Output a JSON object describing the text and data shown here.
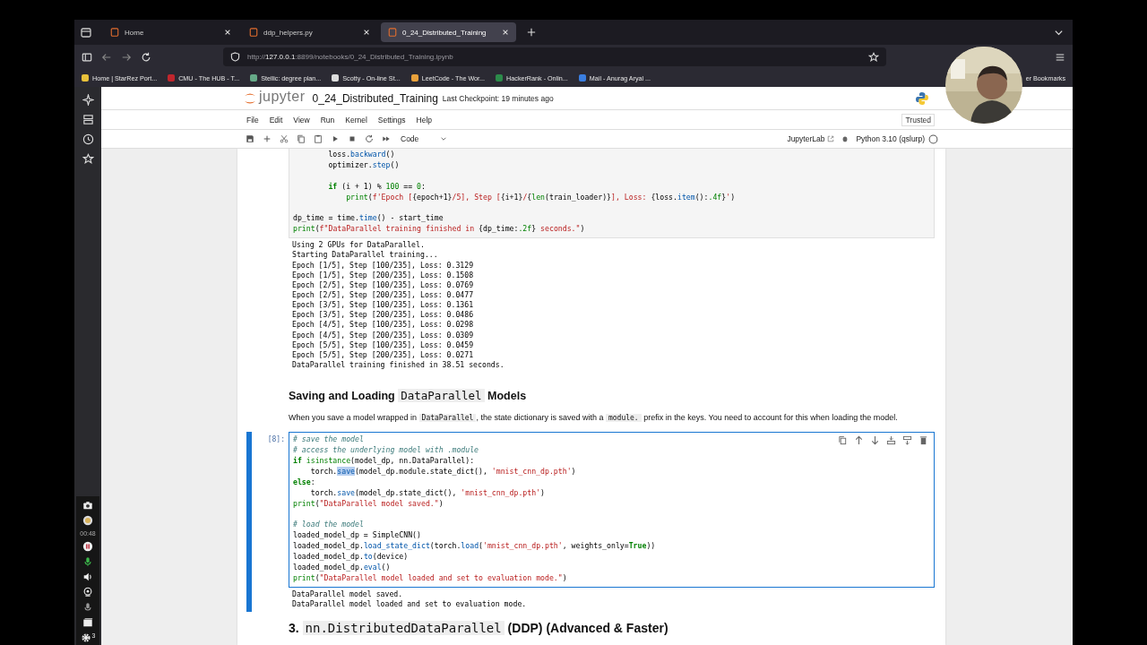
{
  "browser": {
    "tabs": [
      {
        "label": "Home",
        "selected": false
      },
      {
        "label": "ddp_helpers.py",
        "selected": false
      },
      {
        "label": "0_24_Distributed_Training",
        "selected": true
      }
    ],
    "url": {
      "host": "127.0.0.1",
      "prefix": "http://",
      "rest": ":8899/notebooks/0_24_Distributed_Training.ipynb"
    },
    "bookmarks": [
      "Home | StarRez Port...",
      "CMU - The HUB - T...",
      "Stellic: degree plan...",
      "Scotty - On-line St...",
      "LeetCode - The Wor...",
      "HackerRank - Onlin...",
      "Mail - Anurag Aryal ..."
    ],
    "bookmarks_end": "er Bookmarks"
  },
  "jupyter": {
    "logo": "jupyter",
    "title": "0_24_Distributed_Training",
    "checkpoint": "Last Checkpoint: 19 minutes ago",
    "menu": [
      "File",
      "Edit",
      "View",
      "Run",
      "Kernel",
      "Settings",
      "Help"
    ],
    "trusted": "Trusted",
    "cell_type": "Code",
    "jupyterlab": "JupyterLab",
    "kernel": "Python 3.10 (qslurp)"
  },
  "cells": [
    {
      "kind": "code",
      "selected": false,
      "lines": [
        {
          "seg": [
            {
              "kind": "plain",
              "text": "        loss."
            },
            {
              "kind": "attr",
              "text": "backward"
            },
            {
              "kind": "plain",
              "text": "()"
            }
          ]
        },
        {
          "seg": [
            {
              "kind": "plain",
              "text": "        optimizer."
            },
            {
              "kind": "attr",
              "text": "step"
            },
            {
              "kind": "plain",
              "text": "()"
            }
          ]
        },
        {
          "gap": true,
          "seg": [
            {
              "kind": "keyword",
              "text": "        if"
            },
            {
              "kind": "plain",
              "text": " (i + 1) % "
            },
            {
              "kind": "number",
              "text": "100"
            },
            {
              "kind": "plain",
              "text": " == "
            },
            {
              "kind": "number",
              "text": "0"
            },
            {
              "kind": "plain",
              "text": ":"
            }
          ]
        },
        {
          "seg": [
            {
              "kind": "builtin",
              "text": "            print"
            },
            {
              "kind": "plain",
              "text": "("
            },
            {
              "kind": "string",
              "text": "f'Epoch ["
            },
            {
              "kind": "plain",
              "text": "{epoch+1}"
            },
            {
              "kind": "string",
              "text": "/5], Step ["
            },
            {
              "kind": "plain",
              "text": "{i+1}"
            },
            {
              "kind": "string",
              "text": "/"
            },
            {
              "kind": "plain",
              "text": "{"
            },
            {
              "kind": "builtin",
              "text": "len"
            },
            {
              "kind": "plain",
              "text": "(train_loader)}"
            },
            {
              "kind": "string",
              "text": "], Loss: "
            },
            {
              "kind": "plain",
              "text": "{loss."
            },
            {
              "kind": "attr",
              "text": "item"
            },
            {
              "kind": "plain",
              "text": "():"
            },
            {
              "kind": "number",
              "text": ".4f"
            },
            {
              "kind": "plain",
              "text": "}"
            },
            {
              "kind": "string",
              "text": "'"
            },
            {
              "kind": "plain",
              "text": ")"
            }
          ]
        },
        {
          "gap": true,
          "seg": [
            {
              "kind": "plain",
              "text": "dp_time = time."
            },
            {
              "kind": "attr",
              "text": "time"
            },
            {
              "kind": "plain",
              "text": "() - start_time"
            }
          ]
        },
        {
          "seg": [
            {
              "kind": "builtin",
              "text": "print"
            },
            {
              "kind": "plain",
              "text": "("
            },
            {
              "kind": "string",
              "text": "f\"DataParallel training finished in "
            },
            {
              "kind": "plain",
              "text": "{dp_time:"
            },
            {
              "kind": "number",
              "text": ".2f"
            },
            {
              "kind": "plain",
              "text": "}"
            },
            {
              "kind": "string",
              "text": " seconds.\""
            },
            {
              "kind": "plain",
              "text": ")"
            }
          ]
        }
      ],
      "output": [
        "Using 2 GPUs for DataParallel.",
        "Starting DataParallel training...",
        "Epoch [1/5], Step [100/235], Loss: 0.3129",
        "Epoch [1/5], Step [200/235], Loss: 0.1508",
        "Epoch [2/5], Step [100/235], Loss: 0.0769",
        "Epoch [2/5], Step [200/235], Loss: 0.0477",
        "Epoch [3/5], Step [100/235], Loss: 0.1361",
        "Epoch [3/5], Step [200/235], Loss: 0.0486",
        "Epoch [4/5], Step [100/235], Loss: 0.0298",
        "Epoch [4/5], Step [200/235], Loss: 0.0309",
        "Epoch [5/5], Step [100/235], Loss: 0.0459",
        "Epoch [5/5], Step [200/235], Loss: 0.0271",
        "DataParallel training finished in 38.51 seconds."
      ]
    },
    {
      "kind": "markdown",
      "selected": false,
      "heading": {
        "kind": "h2",
        "parts": [
          {
            "text": "Saving and Loading ",
            "code": false
          },
          {
            "text": "DataParallel",
            "code": true
          },
          {
            "text": " Models",
            "code": false
          }
        ]
      },
      "paragraph": [
        {
          "text": "When you save a model wrapped in ",
          "code": false
        },
        {
          "text": "DataParallel",
          "code": true
        },
        {
          "text": ", the state dictionary is saved with a ",
          "code": false
        },
        {
          "text": "module.",
          "code": true
        },
        {
          "text": " prefix in the keys. You need to account for this when loading the model.",
          "code": false
        }
      ]
    },
    {
      "kind": "code",
      "selected": true,
      "prompt": "[8]:",
      "lines": [
        {
          "seg": [
            {
              "kind": "comment",
              "text": "# save the model"
            }
          ]
        },
        {
          "seg": [
            {
              "kind": "comment",
              "text": "# access the underlying model with .module"
            }
          ]
        },
        {
          "seg": [
            {
              "kind": "keyword",
              "text": "if"
            },
            {
              "kind": "builtin",
              "text": " isinstance"
            },
            {
              "kind": "plain",
              "text": "(model_dp, nn.DataParallel):"
            }
          ]
        },
        {
          "seg": [
            {
              "kind": "plain",
              "text": "    torch."
            },
            {
              "kind": "selected",
              "text": "save"
            },
            {
              "kind": "plain",
              "text": "(model_dp.module.state_dict(), "
            },
            {
              "kind": "string",
              "text": "'mnist_cnn_dp.pth'"
            },
            {
              "kind": "plain",
              "text": ")"
            }
          ]
        },
        {
          "seg": [
            {
              "kind": "keyword",
              "text": "else"
            },
            {
              "kind": "plain",
              "text": ":"
            }
          ]
        },
        {
          "seg": [
            {
              "kind": "plain",
              "text": "    torch."
            },
            {
              "kind": "attr",
              "text": "save"
            },
            {
              "kind": "plain",
              "text": "(model_dp.state_dict(), "
            },
            {
              "kind": "string",
              "text": "'mnist_cnn_dp.pth'"
            },
            {
              "kind": "plain",
              "text": ")"
            }
          ]
        },
        {
          "seg": [
            {
              "kind": "builtin",
              "text": "print"
            },
            {
              "kind": "plain",
              "text": "("
            },
            {
              "kind": "string",
              "text": "\"DataParallel model saved.\""
            },
            {
              "kind": "plain",
              "text": ")"
            }
          ]
        },
        {
          "gap": true,
          "seg": [
            {
              "kind": "comment",
              "text": "# load the model"
            }
          ]
        },
        {
          "seg": [
            {
              "kind": "plain",
              "text": "loaded_model_dp = SimpleCNN()"
            }
          ]
        },
        {
          "seg": [
            {
              "kind": "plain",
              "text": "loaded_model_dp."
            },
            {
              "kind": "attr",
              "text": "load_state_dict"
            },
            {
              "kind": "plain",
              "text": "(torch."
            },
            {
              "kind": "attr",
              "text": "load"
            },
            {
              "kind": "plain",
              "text": "("
            },
            {
              "kind": "string",
              "text": "'mnist_cnn_dp.pth'"
            },
            {
              "kind": "plain",
              "text": ", weights_only="
            },
            {
              "kind": "keyword",
              "text": "True"
            },
            {
              "kind": "plain",
              "text": "))"
            }
          ]
        },
        {
          "seg": [
            {
              "kind": "plain",
              "text": "loaded_model_dp."
            },
            {
              "kind": "attr",
              "text": "to"
            },
            {
              "kind": "plain",
              "text": "(device)"
            }
          ]
        },
        {
          "seg": [
            {
              "kind": "plain",
              "text": "loaded_model_dp."
            },
            {
              "kind": "attr",
              "text": "eval"
            },
            {
              "kind": "plain",
              "text": "()"
            }
          ]
        },
        {
          "seg": [
            {
              "kind": "builtin",
              "text": "print"
            },
            {
              "kind": "plain",
              "text": "("
            },
            {
              "kind": "string",
              "text": "\"DataParallel model loaded and set to evaluation mode.\""
            },
            {
              "kind": "plain",
              "text": ")"
            }
          ]
        }
      ],
      "output": [
        "DataParallel model saved.",
        "DataParallel model loaded and set to evaluation mode."
      ]
    },
    {
      "kind": "markdown",
      "selected": false,
      "heading": {
        "kind": "h1",
        "parts": [
          {
            "text": "3. ",
            "code": false
          },
          {
            "text": "nn.DistributedDataParallel",
            "code": true
          },
          {
            "text": " (DDP) (Advanced & Faster)",
            "code": false
          }
        ]
      }
    }
  ],
  "recorder": {
    "timer": "00:48",
    "count": "3"
  }
}
